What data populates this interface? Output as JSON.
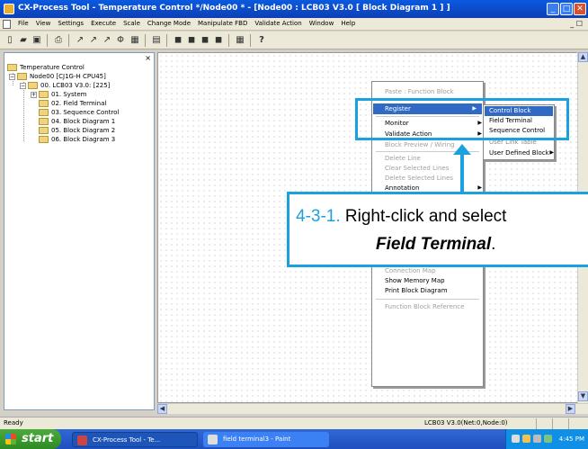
{
  "window": {
    "title": "CX-Process Tool - Temperature Control */Node00 * - [Node00 : LCB03 V3.0 [ Block Diagram 1 ] ]",
    "minimize": "_",
    "maximize": "□",
    "close": "✕"
  },
  "menu": {
    "items": [
      "File",
      "View",
      "Settings",
      "Execute",
      "Scale",
      "Change Mode",
      "Manipulate FBD",
      "Validate Action",
      "Window",
      "Help"
    ],
    "doc_controls": "_ ☐"
  },
  "toolbar": {
    "buttons": [
      "new",
      "open",
      "save",
      "print",
      "tool-a",
      "tool-b",
      "tool-c",
      "tool-d",
      "tool-e",
      "tool-f",
      "tool-g",
      "tool-h",
      "tool-i",
      "tool-j",
      "tool-k",
      "help"
    ]
  },
  "tree": {
    "close": "×",
    "root": "Temperature Control",
    "node": "Node00 [CJ1G-H CPU45]",
    "unit": "00. LCB03 V3.0: [225]",
    "items": [
      "01. System",
      "02. Field Terminal",
      "03. Sequence Control",
      "04. Block Diagram 1",
      "05. Block Diagram 2",
      "06. Block Diagram 3"
    ]
  },
  "context_menu": {
    "paste": "Paste : Function Block",
    "register": "Register",
    "monitor": "Monitor",
    "validate": "Validate Action",
    "hidden_partial": "Block Preview / Wiring",
    "delete_line": "Delete Line",
    "clear_selected": "Clear Selected Lines",
    "delete_selected": "Delete Selected Lines",
    "annotation": "Annotation",
    "connection_map": "Connection Map",
    "show_memory": "Show Memory Map",
    "print_diagram": "Print Block Diagram",
    "fb_reference": "Function Block Reference"
  },
  "submenu": {
    "items": [
      "Control Block",
      "Field Terminal",
      "Sequence Control",
      "User Link Table",
      "User Defined Block"
    ]
  },
  "callout": {
    "step": "4-3-1.",
    "line1": "Right-click and select",
    "line2_bold": "Field Terminal",
    "line2_end": "."
  },
  "status": {
    "left": "Ready",
    "mid": "LCB03 V3.0(Net:0,Node:0)"
  },
  "taskbar": {
    "start": "start",
    "tasks": [
      "CX-Process Tool - Te...",
      "field terminal3 - Paint"
    ],
    "clock": "4:45 PM"
  },
  "colors": {
    "highlight": "#1ba1de",
    "menu_select": "#316ac5",
    "title_bar": "#0a5adf"
  }
}
